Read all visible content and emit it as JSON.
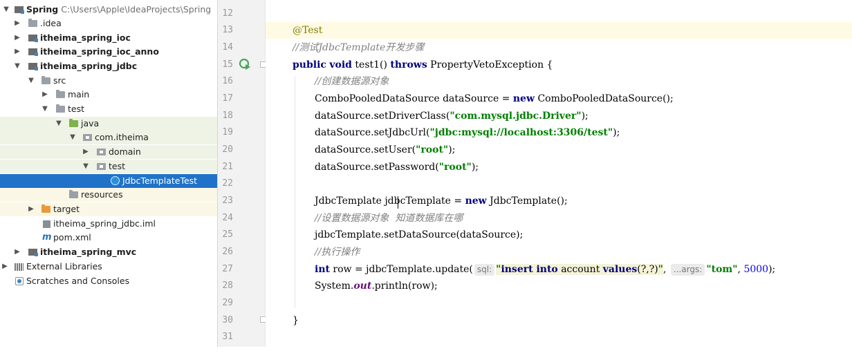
{
  "tree": {
    "rows": [
      {
        "label": "Spring",
        "path": "C:\\Users\\Apple\\IdeaProjects\\Spring"
      },
      {
        "label": ".idea"
      },
      {
        "label": "itheima_spring_ioc"
      },
      {
        "label": "itheima_spring_ioc_anno"
      },
      {
        "label": "itheima_spring_jdbc"
      },
      {
        "label": "src"
      },
      {
        "label": "main"
      },
      {
        "label": "test"
      },
      {
        "label": "java"
      },
      {
        "label": "com.itheima"
      },
      {
        "label": "domain"
      },
      {
        "label": "test"
      },
      {
        "label": "JdbcTemplateTest"
      },
      {
        "label": "resources"
      },
      {
        "label": "target"
      },
      {
        "label": "itheima_spring_jdbc.iml"
      },
      {
        "label": "pom.xml"
      },
      {
        "label": "itheima_spring_mvc"
      },
      {
        "label": "External Libraries"
      },
      {
        "label": "Scratches and Consoles"
      }
    ]
  },
  "editor": {
    "line_numbers": [
      "12",
      "13",
      "14",
      "15",
      "16",
      "17",
      "18",
      "19",
      "20",
      "21",
      "22",
      "23",
      "24",
      "25",
      "26",
      "27",
      "28",
      "29",
      "30",
      "31"
    ],
    "code": {
      "l13_ann": "@Test",
      "l14_cmt": "//测试",
      "l14_cmt_it": "JdbcTemplate",
      "l14_cmt_tail": "开发步骤",
      "l15_public": "public",
      "l15_void": "void",
      "l15_name": " test1() ",
      "l15_throws": "throws",
      "l15_tail": " PropertyVetoException {",
      "l16_cmt": "//创建数据源对象",
      "l17_a": "ComboPooledDataSource dataSource = ",
      "l17_new": "new",
      "l17_b": " ComboPooledDataSource();",
      "l18_a": "dataSource.setDriverClass(",
      "l18_str": "\"com.mysql.jdbc.Driver\"",
      "l18_b": ");",
      "l19_a": "dataSource.setJdbcUrl(",
      "l19_str": "\"jdbc:mysql://localhost:3306/test\"",
      "l19_b": ");",
      "l20_a": "dataSource.setUser(",
      "l20_str": "\"root\"",
      "l20_b": ");",
      "l21_a": "dataSource.setPassword(",
      "l21_str": "\"root\"",
      "l21_b": ");",
      "l23_a": "JdbcTemplate jdbcTemplate = ",
      "l23_new": "new",
      "l23_b": " JdbcTemplate();",
      "l24_cmt": "//设置数据源对象  知道数据库在哪",
      "l25": "jdbcTemplate.setDataSource(dataSource);",
      "l26_cmt": "//执行操作",
      "l27_int": "int",
      "l27_a": " row = jdbcTemplate.update(",
      "l27_hint1": "sql:",
      "l27_q1": "\"",
      "l27_insert": "insert into",
      "l27_account": " account ",
      "l27_values": "values",
      "l27_params": "(?,?)",
      "l27_q2": "\"",
      "l27_comma": ", ",
      "l27_hint2": "...args:",
      "l27_tom": "\"tom\"",
      "l27_comma2": ", ",
      "l27_num": "5000",
      "l27_end": ");",
      "l28_a": "System.",
      "l28_out": "out",
      "l28_b": ".println(row);",
      "l30": "}"
    }
  }
}
